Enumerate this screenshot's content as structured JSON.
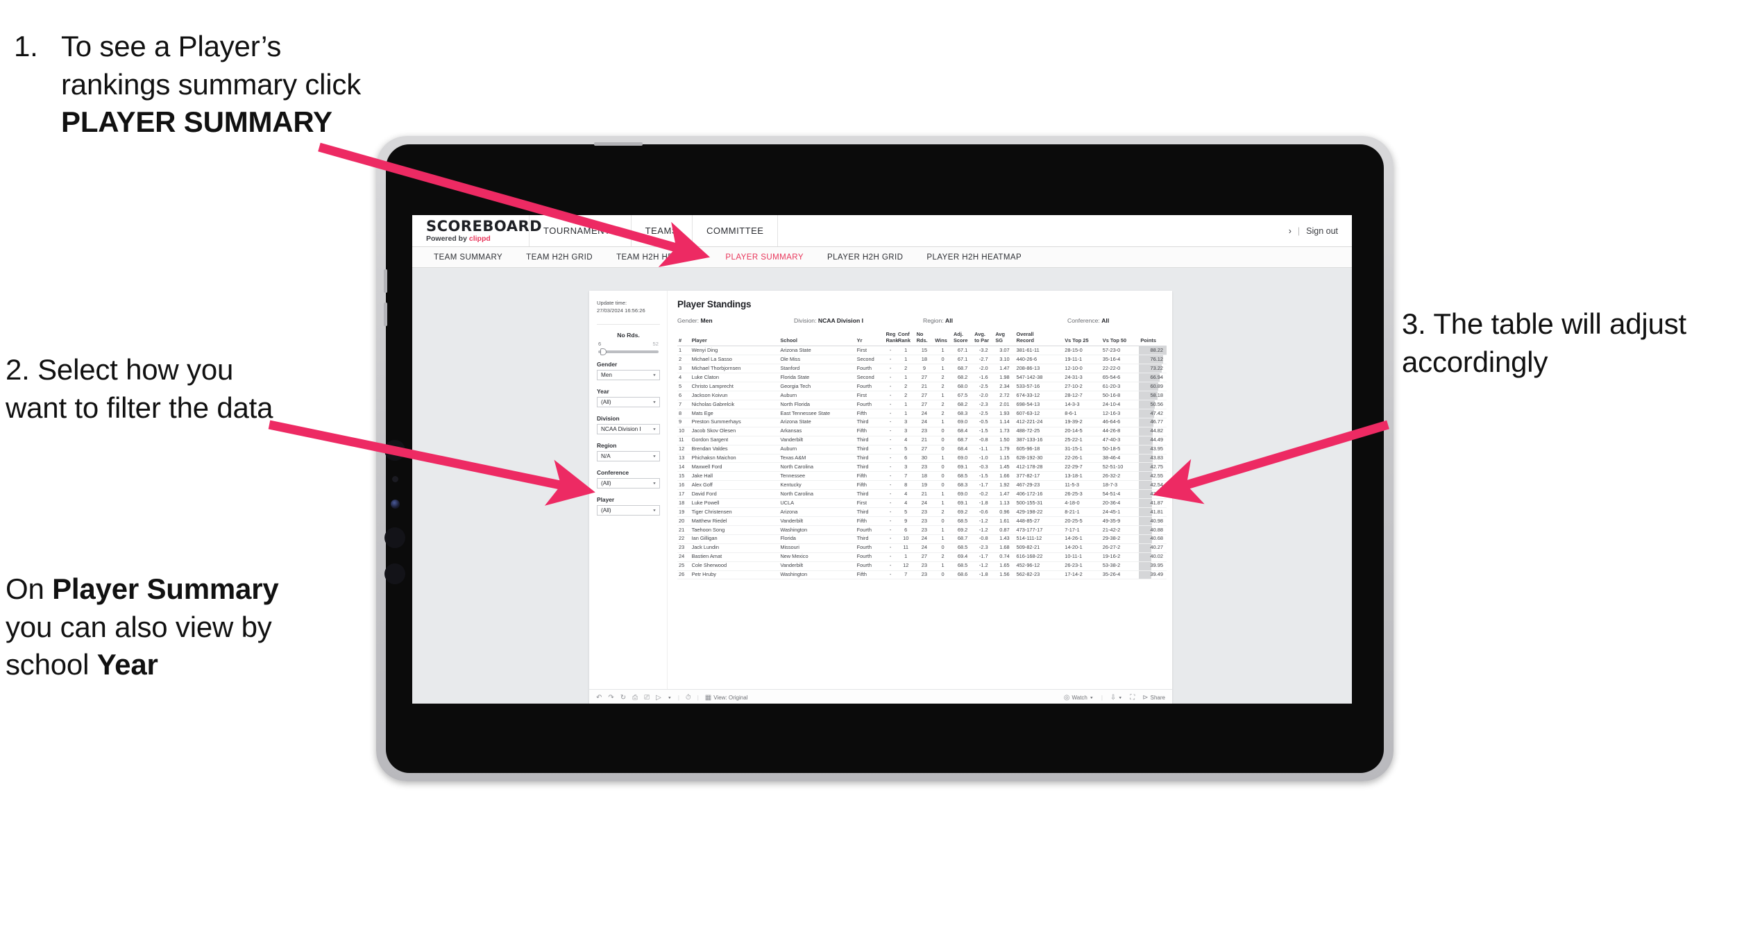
{
  "annotations": [
    {
      "id": "step1",
      "number": "1.",
      "text_before": "To see a Player’s rankings summary click ",
      "bold": "PLAYER SUMMARY",
      "text_after": ""
    },
    {
      "id": "step2",
      "number": "2.",
      "full": "2. Select how you want to filter the data"
    },
    {
      "id": "step2b",
      "lead": "On ",
      "bold1": "Player Summary",
      "mid": " you can also view by school ",
      "bold2": "Year"
    },
    {
      "id": "step3",
      "full": "3. The table will adjust accordingly"
    }
  ],
  "accent_color": "#ED2A63",
  "brand_color": "#E8355A",
  "app": {
    "brand": {
      "logo": "SCOREBOARD",
      "powered_prefix": "Powered by ",
      "powered_name": "clippd"
    },
    "top_nav": [
      {
        "label": "TOURNAMENTS"
      },
      {
        "label": "TEAMS"
      },
      {
        "label": "COMMITTEE"
      }
    ],
    "header_right": {
      "user": "›",
      "separator": "|",
      "sign_out": "Sign out"
    },
    "sub_nav": [
      {
        "label": "TEAM SUMMARY",
        "active": false
      },
      {
        "label": "TEAM H2H GRID",
        "active": false
      },
      {
        "label": "TEAM H2H HEATMAP",
        "active": false
      },
      {
        "label": "PLAYER SUMMARY",
        "active": true
      },
      {
        "label": "PLAYER H2H GRID",
        "active": false
      },
      {
        "label": "PLAYER H2H HEATMAP",
        "active": false
      }
    ]
  },
  "filters": {
    "update_label": "Update time:",
    "update_value": "27/03/2024 16:56:26",
    "slider": {
      "label": "No Rds.",
      "min": "6",
      "max": "52"
    },
    "selects": [
      {
        "label": "Gender",
        "value": "Men"
      },
      {
        "label": "Year",
        "value": "(All)"
      },
      {
        "label": "Division",
        "value": "NCAA Division I"
      },
      {
        "label": "Region",
        "value": "N/A"
      },
      {
        "label": "Conference",
        "value": "(All)"
      },
      {
        "label": "Player",
        "value": "(All)"
      }
    ]
  },
  "viz": {
    "title": "Player Standings",
    "filter_summary": [
      {
        "label": "Gender:",
        "value": "Men"
      },
      {
        "label": "Division:",
        "value": "NCAA Division I"
      },
      {
        "label": "Region:",
        "value": "All"
      },
      {
        "label": "Conference:",
        "value": "All"
      }
    ],
    "columns": [
      {
        "key": "rank",
        "line1": "#",
        "line2": ""
      },
      {
        "key": "player",
        "line1": "Player",
        "line2": ""
      },
      {
        "key": "school",
        "line1": "School",
        "line2": ""
      },
      {
        "key": "yr",
        "line1": "Yr",
        "line2": ""
      },
      {
        "key": "reg_rank",
        "line1": "Reg",
        "line2": "Rank"
      },
      {
        "key": "conf_rank",
        "line1": "Conf",
        "line2": "Rank"
      },
      {
        "key": "no_rds",
        "line1": "No",
        "line2": "Rds."
      },
      {
        "key": "wins",
        "line1": "Wins",
        "line2": ""
      },
      {
        "key": "adj_score",
        "line1": "Adj.",
        "line2": "Score"
      },
      {
        "key": "avg_to_par",
        "line1": "Avg.",
        "line2": "to Par"
      },
      {
        "key": "avg_sg",
        "line1": "Avg",
        "line2": "SG"
      },
      {
        "key": "overall_record",
        "line1": "Overall",
        "line2": "Record"
      },
      {
        "key": "vs_top25",
        "line1": "Vs Top 25",
        "line2": ""
      },
      {
        "key": "vs_top50",
        "line1": "Vs Top 50",
        "line2": ""
      },
      {
        "key": "points",
        "line1": "Points",
        "line2": ""
      }
    ],
    "rows": [
      {
        "rank": "1",
        "player": "Wenyi Ding",
        "school": "Arizona State",
        "yr": "First",
        "reg_rank": "-",
        "conf_rank": "1",
        "no_rds": "15",
        "wins": "1",
        "adj_score": "67.1",
        "avg_to_par": "-3.2",
        "avg_sg": "3.07",
        "overall_record": "381-61-11",
        "vs_top25": "28-15-0",
        "vs_top50": "57-23-0",
        "points": "88.22"
      },
      {
        "rank": "2",
        "player": "Michael La Sasso",
        "school": "Ole Miss",
        "yr": "Second",
        "reg_rank": "-",
        "conf_rank": "1",
        "no_rds": "18",
        "wins": "0",
        "adj_score": "67.1",
        "avg_to_par": "-2.7",
        "avg_sg": "3.10",
        "overall_record": "440-26-6",
        "vs_top25": "19-11-1",
        "vs_top50": "35-16-4",
        "points": "76.12"
      },
      {
        "rank": "3",
        "player": "Michael Thorbjornsen",
        "school": "Stanford",
        "yr": "Fourth",
        "reg_rank": "-",
        "conf_rank": "2",
        "no_rds": "9",
        "wins": "1",
        "adj_score": "68.7",
        "avg_to_par": "-2.0",
        "avg_sg": "1.47",
        "overall_record": "208-86-13",
        "vs_top25": "12-10-0",
        "vs_top50": "22-22-0",
        "points": "73.22"
      },
      {
        "rank": "4",
        "player": "Luke Claton",
        "school": "Florida State",
        "yr": "Second",
        "reg_rank": "-",
        "conf_rank": "1",
        "no_rds": "27",
        "wins": "2",
        "adj_score": "68.2",
        "avg_to_par": "-1.6",
        "avg_sg": "1.98",
        "overall_record": "547-142-38",
        "vs_top25": "24-31-3",
        "vs_top50": "65-54-6",
        "points": "66.94"
      },
      {
        "rank": "5",
        "player": "Christo Lamprecht",
        "school": "Georgia Tech",
        "yr": "Fourth",
        "reg_rank": "-",
        "conf_rank": "2",
        "no_rds": "21",
        "wins": "2",
        "adj_score": "68.0",
        "avg_to_par": "-2.5",
        "avg_sg": "2.34",
        "overall_record": "533-57-16",
        "vs_top25": "27-10-2",
        "vs_top50": "61-20-3",
        "points": "60.89"
      },
      {
        "rank": "6",
        "player": "Jackson Koivun",
        "school": "Auburn",
        "yr": "First",
        "reg_rank": "-",
        "conf_rank": "2",
        "no_rds": "27",
        "wins": "1",
        "adj_score": "67.5",
        "avg_to_par": "-2.0",
        "avg_sg": "2.72",
        "overall_record": "674-33-12",
        "vs_top25": "28-12-7",
        "vs_top50": "50-16-8",
        "points": "58.18"
      },
      {
        "rank": "7",
        "player": "Nicholas Gabrelcik",
        "school": "North Florida",
        "yr": "Fourth",
        "reg_rank": "-",
        "conf_rank": "1",
        "no_rds": "27",
        "wins": "2",
        "adj_score": "68.2",
        "avg_to_par": "-2.3",
        "avg_sg": "2.01",
        "overall_record": "698-54-13",
        "vs_top25": "14-3-3",
        "vs_top50": "24-10-4",
        "points": "50.56"
      },
      {
        "rank": "8",
        "player": "Mats Ege",
        "school": "East Tennessee State",
        "yr": "Fifth",
        "reg_rank": "-",
        "conf_rank": "1",
        "no_rds": "24",
        "wins": "2",
        "adj_score": "68.3",
        "avg_to_par": "-2.5",
        "avg_sg": "1.93",
        "overall_record": "607-63-12",
        "vs_top25": "8-6-1",
        "vs_top50": "12-16-3",
        "points": "47.42"
      },
      {
        "rank": "9",
        "player": "Preston Summerhays",
        "school": "Arizona State",
        "yr": "Third",
        "reg_rank": "-",
        "conf_rank": "3",
        "no_rds": "24",
        "wins": "1",
        "adj_score": "69.0",
        "avg_to_par": "-0.5",
        "avg_sg": "1.14",
        "overall_record": "412-221-24",
        "vs_top25": "19-39-2",
        "vs_top50": "46-64-6",
        "points": "46.77"
      },
      {
        "rank": "10",
        "player": "Jacob Skov Olesen",
        "school": "Arkansas",
        "yr": "Fifth",
        "reg_rank": "-",
        "conf_rank": "3",
        "no_rds": "23",
        "wins": "0",
        "adj_score": "68.4",
        "avg_to_par": "-1.5",
        "avg_sg": "1.73",
        "overall_record": "488-72-25",
        "vs_top25": "20-14-5",
        "vs_top50": "44-26-8",
        "points": "44.82"
      },
      {
        "rank": "11",
        "player": "Gordon Sargent",
        "school": "Vanderbilt",
        "yr": "Third",
        "reg_rank": "-",
        "conf_rank": "4",
        "no_rds": "21",
        "wins": "0",
        "adj_score": "68.7",
        "avg_to_par": "-0.8",
        "avg_sg": "1.50",
        "overall_record": "387-133-16",
        "vs_top25": "25-22-1",
        "vs_top50": "47-40-3",
        "points": "44.49"
      },
      {
        "rank": "12",
        "player": "Brendan Valdes",
        "school": "Auburn",
        "yr": "Third",
        "reg_rank": "-",
        "conf_rank": "5",
        "no_rds": "27",
        "wins": "0",
        "adj_score": "68.4",
        "avg_to_par": "-1.1",
        "avg_sg": "1.79",
        "overall_record": "605-96-18",
        "vs_top25": "31-15-1",
        "vs_top50": "50-18-5",
        "points": "43.95"
      },
      {
        "rank": "13",
        "player": "Phichaksn Maichon",
        "school": "Texas A&M",
        "yr": "Third",
        "reg_rank": "-",
        "conf_rank": "6",
        "no_rds": "30",
        "wins": "1",
        "adj_score": "69.0",
        "avg_to_par": "-1.0",
        "avg_sg": "1.15",
        "overall_record": "628-192-30",
        "vs_top25": "22-26-1",
        "vs_top50": "38-46-4",
        "points": "43.83"
      },
      {
        "rank": "14",
        "player": "Maxwell Ford",
        "school": "North Carolina",
        "yr": "Third",
        "reg_rank": "-",
        "conf_rank": "3",
        "no_rds": "23",
        "wins": "0",
        "adj_score": "69.1",
        "avg_to_par": "-0.3",
        "avg_sg": "1.45",
        "overall_record": "412-178-28",
        "vs_top25": "22-29-7",
        "vs_top50": "52-51-10",
        "points": "42.75"
      },
      {
        "rank": "15",
        "player": "Jake Hall",
        "school": "Tennessee",
        "yr": "Fifth",
        "reg_rank": "-",
        "conf_rank": "7",
        "no_rds": "18",
        "wins": "0",
        "adj_score": "68.5",
        "avg_to_par": "-1.5",
        "avg_sg": "1.66",
        "overall_record": "377-82-17",
        "vs_top25": "13-18-1",
        "vs_top50": "26-32-2",
        "points": "42.55"
      },
      {
        "rank": "16",
        "player": "Alex Goff",
        "school": "Kentucky",
        "yr": "Fifth",
        "reg_rank": "-",
        "conf_rank": "8",
        "no_rds": "19",
        "wins": "0",
        "adj_score": "68.3",
        "avg_to_par": "-1.7",
        "avg_sg": "1.92",
        "overall_record": "467-29-23",
        "vs_top25": "11-5-3",
        "vs_top50": "18-7-3",
        "points": "42.54"
      },
      {
        "rank": "17",
        "player": "David Ford",
        "school": "North Carolina",
        "yr": "Third",
        "reg_rank": "-",
        "conf_rank": "4",
        "no_rds": "21",
        "wins": "1",
        "adj_score": "69.0",
        "avg_to_par": "-0.2",
        "avg_sg": "1.47",
        "overall_record": "406-172-16",
        "vs_top25": "26-25-3",
        "vs_top50": "54-51-4",
        "points": "42.35"
      },
      {
        "rank": "18",
        "player": "Luke Powell",
        "school": "UCLA",
        "yr": "First",
        "reg_rank": "-",
        "conf_rank": "4",
        "no_rds": "24",
        "wins": "1",
        "adj_score": "69.1",
        "avg_to_par": "-1.8",
        "avg_sg": "1.13",
        "overall_record": "500-155-31",
        "vs_top25": "4-18-0",
        "vs_top50": "20-36-4",
        "points": "41.87"
      },
      {
        "rank": "19",
        "player": "Tiger Christensen",
        "school": "Arizona",
        "yr": "Third",
        "reg_rank": "-",
        "conf_rank": "5",
        "no_rds": "23",
        "wins": "2",
        "adj_score": "69.2",
        "avg_to_par": "-0.6",
        "avg_sg": "0.96",
        "overall_record": "429-198-22",
        "vs_top25": "8-21-1",
        "vs_top50": "24-45-1",
        "points": "41.81"
      },
      {
        "rank": "20",
        "player": "Matthew Riedel",
        "school": "Vanderbilt",
        "yr": "Fifth",
        "reg_rank": "-",
        "conf_rank": "9",
        "no_rds": "23",
        "wins": "0",
        "adj_score": "68.5",
        "avg_to_par": "-1.2",
        "avg_sg": "1.61",
        "overall_record": "448-85-27",
        "vs_top25": "20-25-5",
        "vs_top50": "49-35-9",
        "points": "40.98"
      },
      {
        "rank": "21",
        "player": "Taehoon Song",
        "school": "Washington",
        "yr": "Fourth",
        "reg_rank": "-",
        "conf_rank": "6",
        "no_rds": "23",
        "wins": "1",
        "adj_score": "69.2",
        "avg_to_par": "-1.2",
        "avg_sg": "0.87",
        "overall_record": "473-177-17",
        "vs_top25": "7-17-1",
        "vs_top50": "21-42-2",
        "points": "40.88"
      },
      {
        "rank": "22",
        "player": "Ian Gilligan",
        "school": "Florida",
        "yr": "Third",
        "reg_rank": "-",
        "conf_rank": "10",
        "no_rds": "24",
        "wins": "1",
        "adj_score": "68.7",
        "avg_to_par": "-0.8",
        "avg_sg": "1.43",
        "overall_record": "514-111-12",
        "vs_top25": "14-26-1",
        "vs_top50": "29-38-2",
        "points": "40.68"
      },
      {
        "rank": "23",
        "player": "Jack Lundin",
        "school": "Missouri",
        "yr": "Fourth",
        "reg_rank": "-",
        "conf_rank": "11",
        "no_rds": "24",
        "wins": "0",
        "adj_score": "68.5",
        "avg_to_par": "-2.3",
        "avg_sg": "1.68",
        "overall_record": "509-82-21",
        "vs_top25": "14-20-1",
        "vs_top50": "26-27-2",
        "points": "40.27"
      },
      {
        "rank": "24",
        "player": "Bastien Amat",
        "school": "New Mexico",
        "yr": "Fourth",
        "reg_rank": "-",
        "conf_rank": "1",
        "no_rds": "27",
        "wins": "2",
        "adj_score": "69.4",
        "avg_to_par": "-1.7",
        "avg_sg": "0.74",
        "overall_record": "616-168-22",
        "vs_top25": "10-11-1",
        "vs_top50": "19-16-2",
        "points": "40.02"
      },
      {
        "rank": "25",
        "player": "Cole Sherwood",
        "school": "Vanderbilt",
        "yr": "Fourth",
        "reg_rank": "-",
        "conf_rank": "12",
        "no_rds": "23",
        "wins": "1",
        "adj_score": "68.5",
        "avg_to_par": "-1.2",
        "avg_sg": "1.65",
        "overall_record": "452-96-12",
        "vs_top25": "26-23-1",
        "vs_top50": "53-38-2",
        "points": "39.95"
      },
      {
        "rank": "26",
        "player": "Petr Hruby",
        "school": "Washington",
        "yr": "Fifth",
        "reg_rank": "-",
        "conf_rank": "7",
        "no_rds": "23",
        "wins": "0",
        "adj_score": "68.6",
        "avg_to_par": "-1.8",
        "avg_sg": "1.56",
        "overall_record": "562-82-23",
        "vs_top25": "17-14-2",
        "vs_top50": "35-26-4",
        "points": "39.49"
      }
    ],
    "toolbar": {
      "view_label": "View: Original",
      "watch_label": "Watch",
      "share_label": "Share"
    }
  }
}
